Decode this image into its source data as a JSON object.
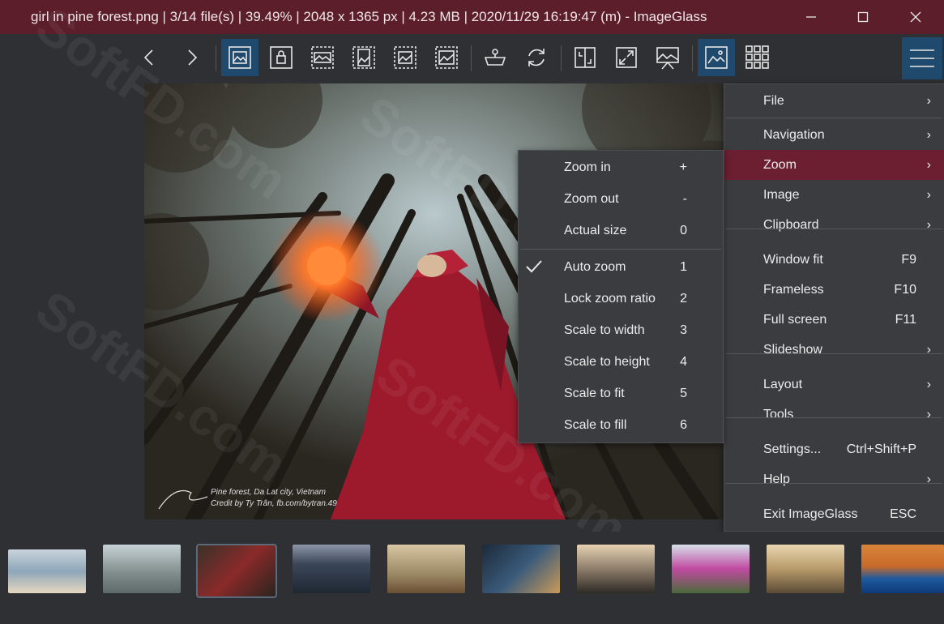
{
  "window": {
    "title": "girl in pine forest.png  |  3/14 file(s)  |  39.49%  |  2048 x 1365 px  |  4.23 MB  |  2020/11/29 16:19:47 (m)  - ImageGlass",
    "accent_color": "#5b1e2a"
  },
  "toolbar": {
    "icons": [
      "previous-icon",
      "next-icon",
      "auto-zoom-icon",
      "lock-zoom-icon",
      "scale-to-width-icon",
      "scale-to-height-icon",
      "window-fit-icon",
      "frameless-icon",
      "open-with-icon",
      "refresh-icon",
      "crop-icon",
      "full-screen-icon",
      "slideshow-icon",
      "thumbnail-bar-icon",
      "grid-icon",
      "main-menu-icon"
    ]
  },
  "image": {
    "caption_line1": "Pine forest, Da Lat city, Vietnam",
    "caption_line2": "Credit by Ty Trân, fb.com/bytran.49"
  },
  "main_menu": {
    "items": [
      {
        "label": "File",
        "shortcut": "",
        "arrow": "›"
      },
      {
        "label": "Navigation",
        "shortcut": "",
        "arrow": "›"
      },
      {
        "label": "Zoom",
        "shortcut": "",
        "arrow": "›"
      },
      {
        "label": "Image",
        "shortcut": "",
        "arrow": "›"
      },
      {
        "label": "Clipboard",
        "shortcut": "",
        "arrow": "›"
      },
      {
        "label": "Window fit",
        "shortcut": "F9",
        "arrow": ""
      },
      {
        "label": "Frameless",
        "shortcut": "F10",
        "arrow": ""
      },
      {
        "label": "Full screen",
        "shortcut": "F11",
        "arrow": ""
      },
      {
        "label": "Slideshow",
        "shortcut": "",
        "arrow": "›"
      },
      {
        "label": "Layout",
        "shortcut": "",
        "arrow": "›"
      },
      {
        "label": "Tools",
        "shortcut": "",
        "arrow": "›"
      },
      {
        "label": "Settings...",
        "shortcut": "Ctrl+Shift+P",
        "arrow": ""
      },
      {
        "label": "Help",
        "shortcut": "",
        "arrow": "›"
      },
      {
        "label": "Exit ImageGlass",
        "shortcut": "ESC",
        "arrow": ""
      }
    ],
    "highlighted": "Zoom",
    "highlight_color": "#6b1f30"
  },
  "zoom_menu": {
    "items": [
      {
        "label": "Zoom in",
        "shortcut": "+",
        "checked": false
      },
      {
        "label": "Zoom out",
        "shortcut": "-",
        "checked": false
      },
      {
        "label": "Actual size",
        "shortcut": "0",
        "checked": false
      },
      {
        "label": "Auto zoom",
        "shortcut": "1",
        "checked": true
      },
      {
        "label": "Lock zoom ratio",
        "shortcut": "2",
        "checked": false
      },
      {
        "label": "Scale to width",
        "shortcut": "3",
        "checked": false
      },
      {
        "label": "Scale to height",
        "shortcut": "4",
        "checked": false
      },
      {
        "label": "Scale to fit",
        "shortcut": "5",
        "checked": false
      },
      {
        "label": "Scale to fill",
        "shortcut": "6",
        "checked": false
      }
    ]
  },
  "watermark": "SoftFD.com",
  "thumbnails": {
    "count_visible": 10
  }
}
